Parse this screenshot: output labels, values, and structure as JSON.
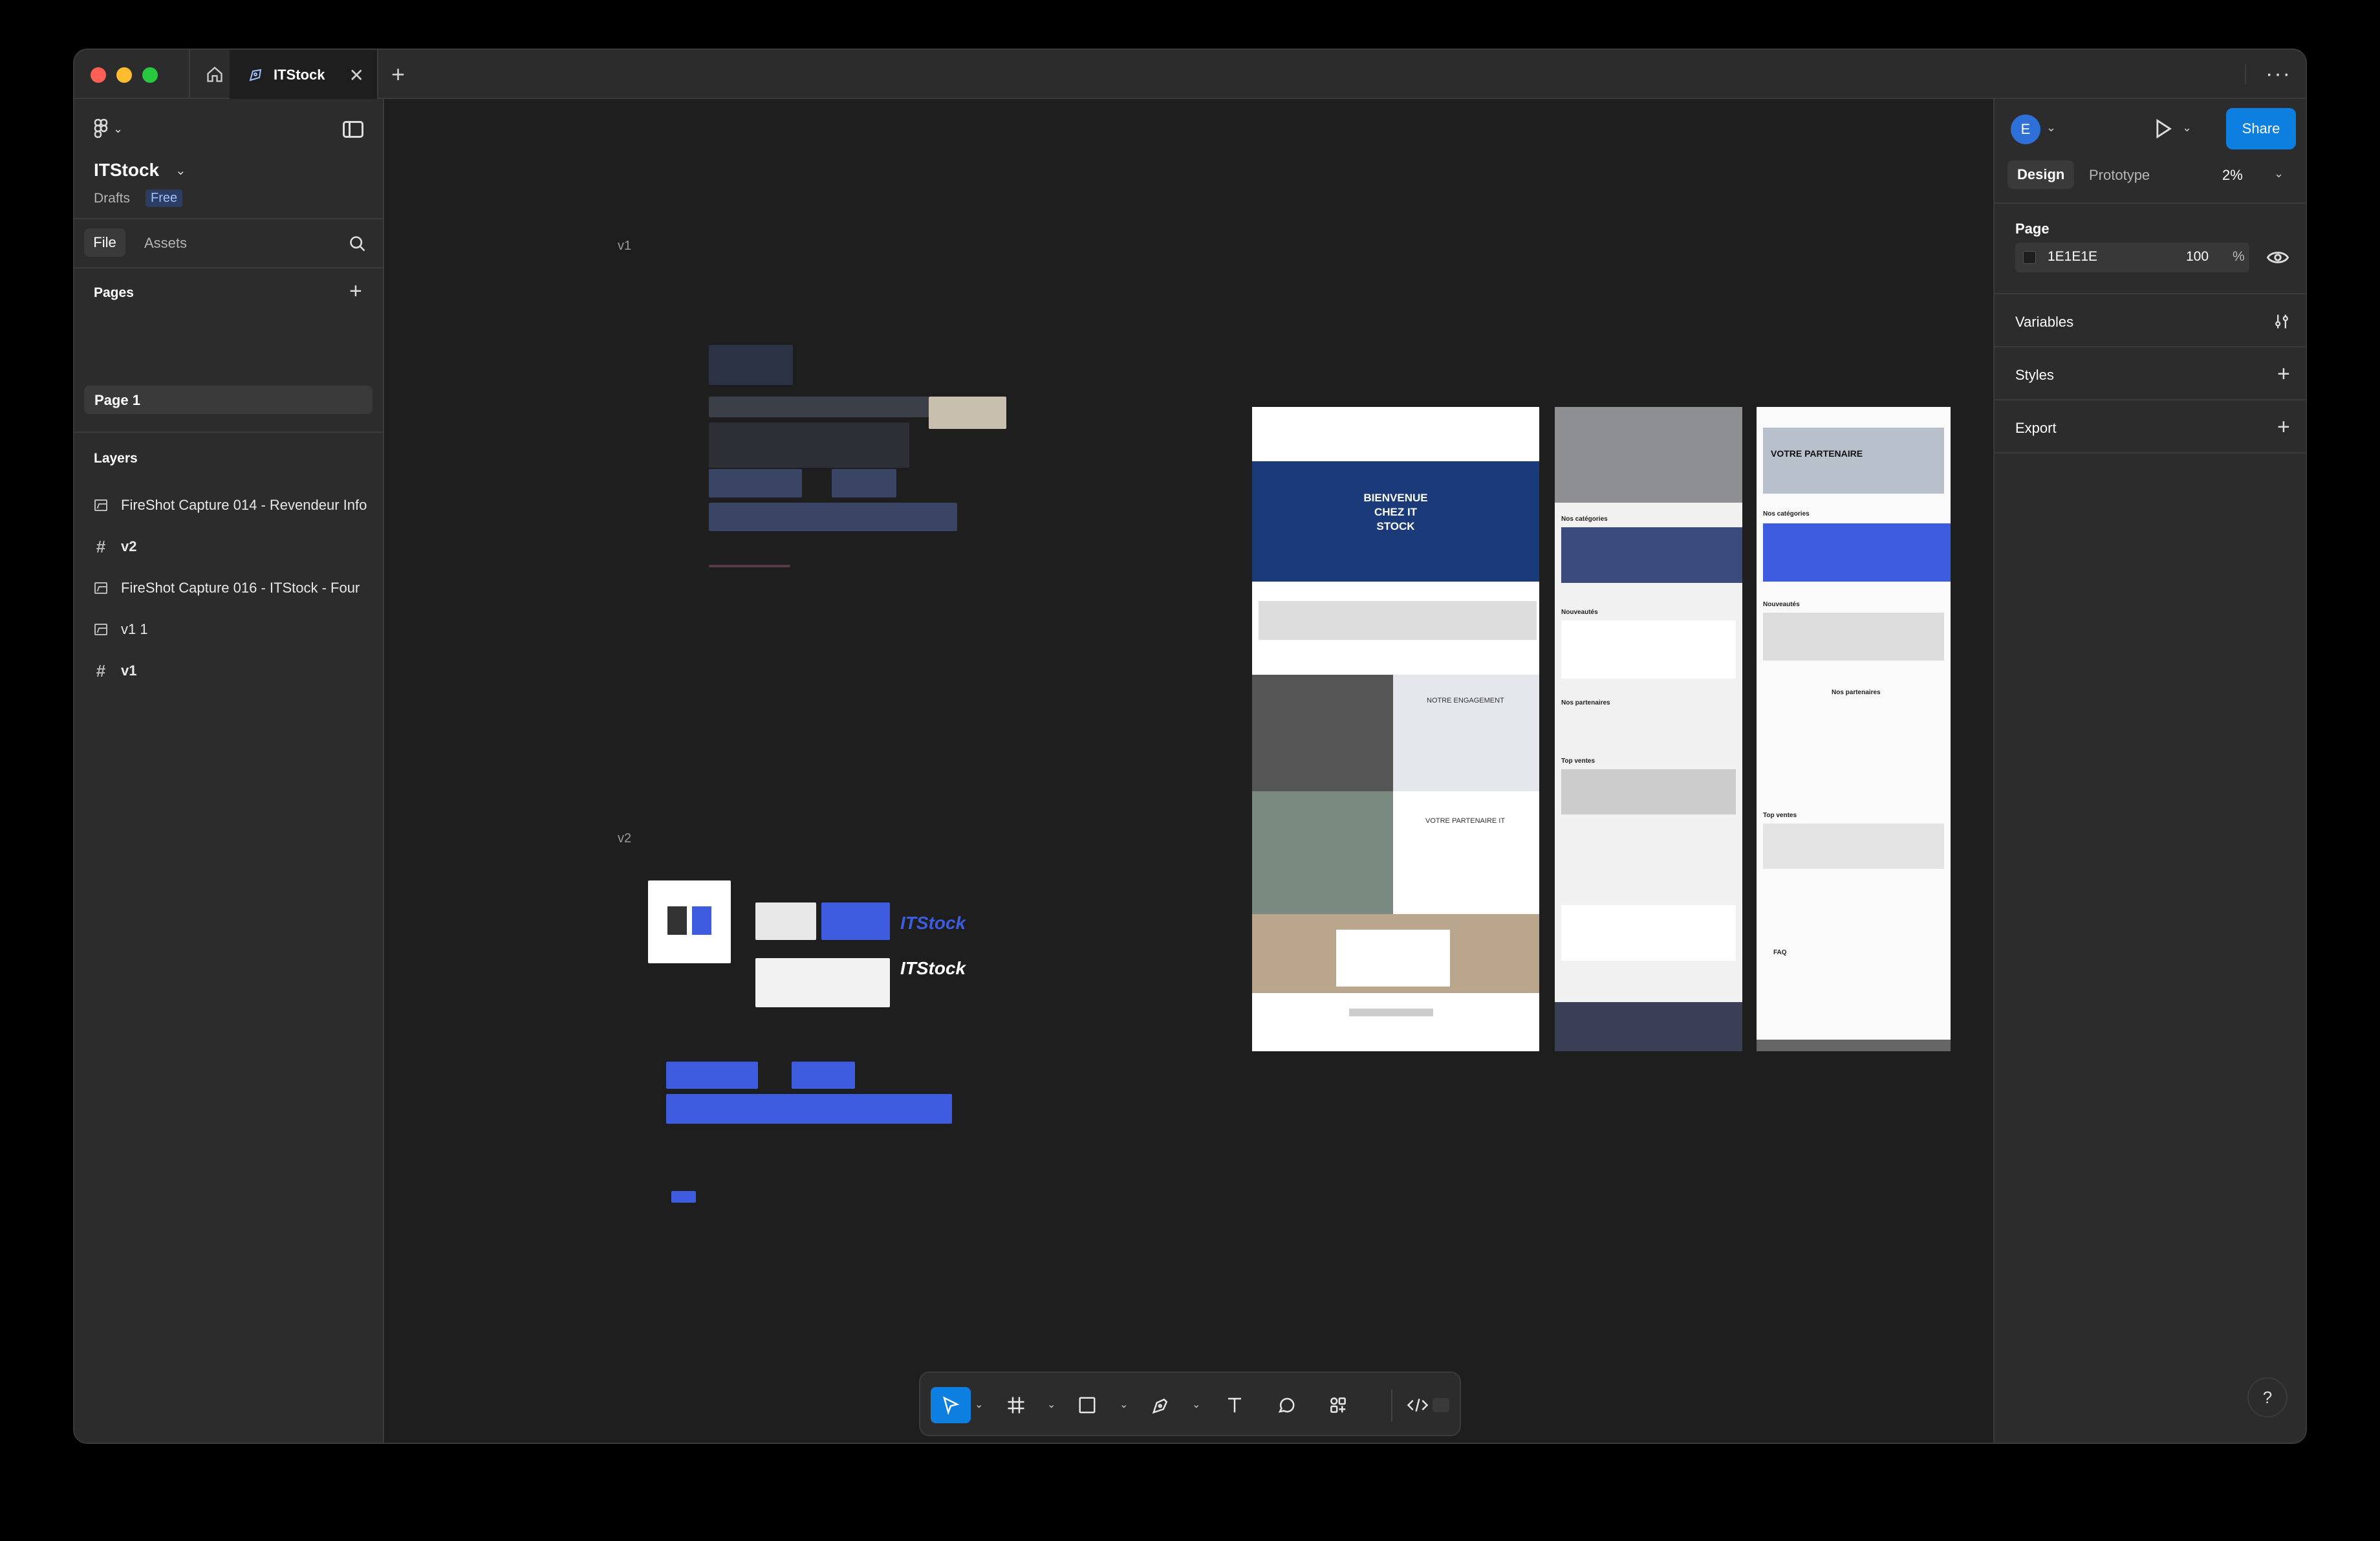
{
  "window": {
    "tab_title": "ITStock",
    "tab_close": "✕",
    "tab_add": "+",
    "more": "···"
  },
  "left_panel": {
    "file_name": "ITStock",
    "location": "Drafts",
    "plan_badge": "Free",
    "tabs": [
      "File",
      "Assets"
    ],
    "pages_heading": "Pages",
    "pages": [
      "Page 1"
    ],
    "layers_heading": "Layers",
    "layers": [
      {
        "label": "FireShot Capture 014 - Revendeur Info",
        "icon": "image-icon"
      },
      {
        "label": "v2",
        "icon": "frame-icon"
      },
      {
        "label": "FireShot Capture 016 - ITStock - Four",
        "icon": "image-icon"
      },
      {
        "label": "v1 1",
        "icon": "image-icon"
      },
      {
        "label": "v1",
        "icon": "frame-icon"
      }
    ]
  },
  "canvas": {
    "labels": [
      "v1",
      "v2"
    ],
    "frames": {
      "hero_text": "BIENVENUE CHEZ IT STOCK",
      "engagement": "NOTRE ENGAGEMENT",
      "partenaire": "VOTRE PARTENAIRE IT",
      "categories": "Nos catégories",
      "nouveautes": "Nouveautés",
      "partenaires": "Nos partenaires",
      "top_ventes": "Top ventes",
      "faq": "FAQ",
      "partenaire_banner": "VOTRE PARTENAIRE",
      "brand": "ITStock"
    }
  },
  "right_panel": {
    "avatar_initial": "E",
    "share_label": "Share",
    "tabs": [
      "Design",
      "Prototype"
    ],
    "zoom": "2%",
    "page_heading": "Page",
    "fill_hex": "1E1E1E",
    "fill_opacity": "100",
    "fill_unit": "%",
    "sections": [
      "Variables",
      "Styles",
      "Export"
    ],
    "help": "?"
  },
  "colors": {
    "accent": "#0d7fe0",
    "canvas_bg": "#1E1E1E",
    "panel_bg": "#2c2c2c",
    "brand_blue": "#3d5ce0"
  }
}
